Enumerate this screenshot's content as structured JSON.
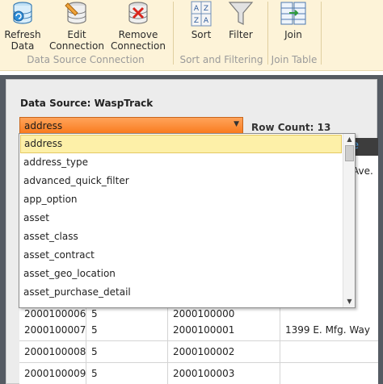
{
  "ribbon": {
    "refresh_label": "Refresh\nData",
    "edit_label": "Edit\nConnection",
    "remove_label": "Remove\nConnection",
    "sort_label": "Sort",
    "filter_label": "Filter",
    "join_label": "Join",
    "group_datasource": "Data Source Connection",
    "group_sort": "Sort and Filtering",
    "group_join": "Join Table",
    "sort_icon_letters": [
      "A",
      "Z",
      "Z",
      "A"
    ]
  },
  "datasource": {
    "label": "Data Source: WaspTrack",
    "selected_table": "address",
    "row_count": "Row Count: 13"
  },
  "dropdown": {
    "items": [
      "address",
      "address_type",
      "advanced_quick_filter",
      "app_option",
      "asset",
      "asset_class",
      "asset_contract",
      "asset_geo_location",
      "asset_purchase_detail"
    ],
    "selected_index": 0
  },
  "grid": {
    "partial_header_text": "e",
    "partial_cell_text": "Ave.",
    "rows": [
      [
        "2000100006",
        "5",
        "2000100000",
        ""
      ],
      [
        "2000100007",
        "5",
        "2000100001",
        "1399 E. Mfg. Way"
      ],
      [
        "2000100008",
        "5",
        "2000100002",
        ""
      ],
      [
        "2000100009",
        "5",
        "2000100003",
        ""
      ]
    ]
  },
  "colors": {
    "ribbon_bg": "#fdf3d8",
    "combo_orange": "#f97a1c",
    "selected_item": "#fdf0a8",
    "frame_dark": "#555b63"
  }
}
